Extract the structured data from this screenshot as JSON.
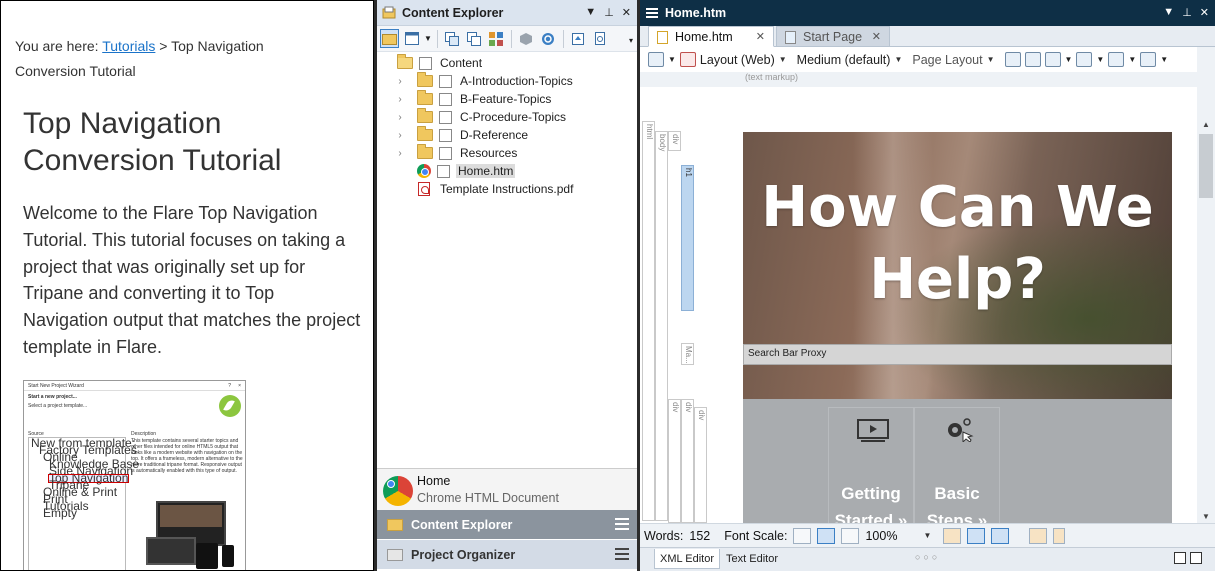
{
  "preview": {
    "breadcrumb_prefix": "You are here:",
    "breadcrumb_link": "Tutorials",
    "breadcrumb_rest": "> Top Navigation Conversion Tutorial",
    "title": "Top Navigation Conversion Tutorial",
    "intro": "Welcome to the Flare Top Navigation Tutorial. This tutorial focuses on taking a project that was originally set up for Tripane and converting it to Top Navigation output that matches the project template in Flare.",
    "wizard": {
      "title": "Start New Project Wizard",
      "heading": "Start a new project...",
      "subheading": "Select a project template...",
      "source_label": "Source",
      "description_label": "Description",
      "new_from_template": "New from template:",
      "tree": [
        "Factory Templates",
        "Online",
        "Knowledge Base",
        "Side Navigation",
        "Top Navigation",
        "Tripane",
        "Online & Print",
        "Print",
        "Tutorials",
        "Empty"
      ],
      "description": "This template contains several starter topics and other files intended for online HTML5 output that looks like a modern website with navigation on the top. It offers a frameless, modern alternative to the more traditional tripane format. Responsive output is automatically enabled with this type of output."
    }
  },
  "explorer": {
    "title": "Content Explorer",
    "tree": {
      "root": "Content",
      "folders": [
        "A-Introduction-Topics",
        "B-Feature-Topics",
        "C-Procedure-Topics",
        "D-Reference",
        "Resources"
      ],
      "files": [
        "Home.htm",
        "Template Instructions.pdf"
      ]
    },
    "info": {
      "name": "Home",
      "type": "Chrome HTML Document"
    },
    "pane_tabs": [
      "Content Explorer",
      "Project Organizer"
    ]
  },
  "editor": {
    "window_title": "Home.htm",
    "tabs": [
      "Home.htm",
      "Start Page"
    ],
    "toolbar": {
      "layout": "Layout (Web)",
      "medium": "Medium (default)",
      "page_layout": "Page Layout"
    },
    "text_markup": "(text markup)",
    "structure_tags": [
      "html",
      "body",
      "div",
      "h1",
      "Ma...",
      "div",
      "div",
      "div"
    ],
    "hero_heading": "How Can We Help?",
    "search_bar": "Search Bar Proxy",
    "cards": [
      "Getting Started »",
      "Basic Steps »"
    ],
    "status": {
      "words_label": "Words:",
      "words": "152",
      "font_scale_label": "Font Scale:",
      "zoom": "100%"
    },
    "bottom_tabs": [
      "XML Editor",
      "Text Editor"
    ],
    "dots": "○○○"
  },
  "colors": {
    "caption_dark": "#0e2f46",
    "caption_light": "#dbe4ef",
    "active_pane_tab": "#8b949e",
    "link": "#1a73c9"
  }
}
